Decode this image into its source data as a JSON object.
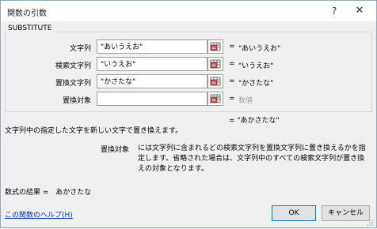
{
  "window": {
    "title": "関数の引数",
    "help_glyph": "?",
    "close_glyph": "✕"
  },
  "function_name": "SUBSTITUTE",
  "arguments": [
    {
      "label": "文字列",
      "value": "\"あいうえお\"",
      "equals": "=",
      "result": "\"あいうえお\"",
      "result_muted": false
    },
    {
      "label": "検索文字列",
      "value": "\"いうえお\"",
      "equals": "=",
      "result": "\"いうえお\"",
      "result_muted": false
    },
    {
      "label": "置換文字列",
      "value": "\"かさたな\"",
      "equals": "=",
      "result": "\"かさたな\"",
      "result_muted": false
    },
    {
      "label": "置換対象",
      "value": "",
      "equals": "=",
      "result": "数値",
      "result_muted": true
    }
  ],
  "final_result": "= \"あかさたな\"",
  "description": "文字列中の指定した文字を新しい文字で置き換えます。",
  "argument_help": {
    "name": "置換対象",
    "text": "には文字列に含まれるどの検索文字列を置換文字列に置き換えるかを指定します。省略された場合は、文字列中のすべての検索文字列が置き換えの対象となります。"
  },
  "formula_result": {
    "label": "数式の結果 =",
    "value": "あかさたな"
  },
  "help_link": "この関数のヘルプ(H)",
  "buttons": {
    "ok": "OK",
    "cancel": "キャンセル"
  },
  "colors": {
    "link": "#0033cc",
    "accent": "#0078d7",
    "muted": "#a0a0a0"
  }
}
